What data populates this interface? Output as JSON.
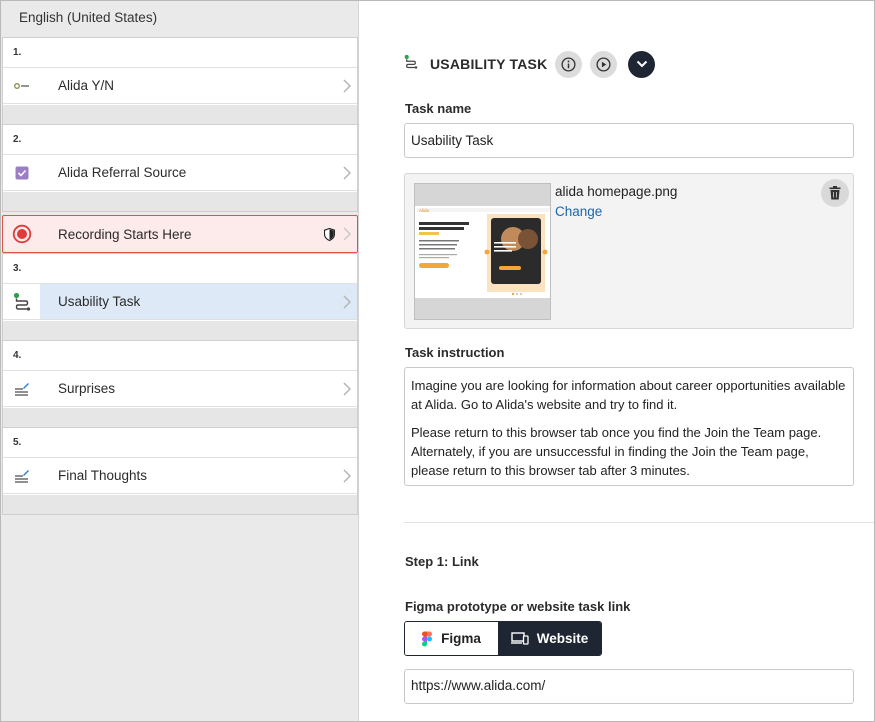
{
  "language": "English (United States)",
  "questions": [
    {
      "number": "1.",
      "label": "Alida Y/N",
      "icon": "yes-no-icon"
    },
    {
      "number": "2.",
      "label": "Alida Referral Source",
      "icon": "checkbox-icon"
    },
    {
      "number": "3.",
      "label": "Usability Task",
      "icon": "route-icon"
    },
    {
      "number": "4.",
      "label": "Surprises",
      "icon": "text-edit-icon"
    },
    {
      "number": "5.",
      "label": "Final Thoughts",
      "icon": "text-edit-icon"
    }
  ],
  "recording": {
    "label": "Recording Starts Here",
    "icon": "record-icon"
  },
  "task": {
    "title": "USABILITY TASK",
    "task_name_label": "Task name",
    "task_name_value": "Usability Task",
    "image_filename": "alida homepage.png",
    "image_change": "Change",
    "thumbnail": {
      "brand": "Alida",
      "headline": "The Easier & Faster Way to Gain Actionable Insights",
      "card_text": "Alida's Community-Driven User Experiences"
    },
    "instruction_label": "Task instruction",
    "instruction_p1": "Imagine you are looking for information about career opportunities available at Alida. Go to Alida's website and try to find it.",
    "instruction_p2": "Please return to this browser tab once you find the Join the Team page. Alternately, if you are unsuccessful in finding the Join the Team page, please return to this browser tab after 3 minutes.",
    "step_label": "Step 1: Link",
    "link_type_label": "Figma prototype or website task link",
    "option_figma": "Figma",
    "option_website": "Website",
    "selected_option": "Website",
    "link_value": "https://www.alida.com/"
  },
  "colors": {
    "accent_dark": "#1e2633",
    "selected_row": "#dde9f6",
    "recording_bg": "#fdeaea",
    "recording_border": "#d9534f",
    "link": "#1a66b0",
    "checkbox": "#9b7fc4"
  }
}
